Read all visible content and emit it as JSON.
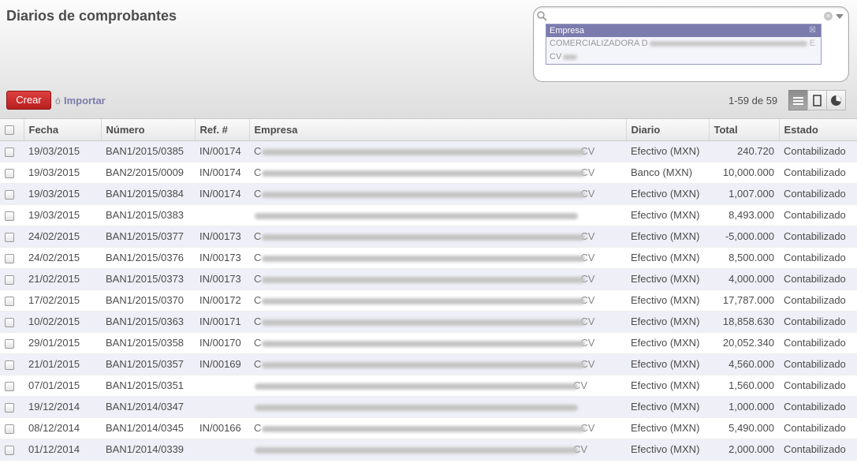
{
  "page": {
    "title": "Diarios de comprobantes"
  },
  "search": {
    "facet_label": "Empresa",
    "facet_values": [
      "COMERCIALIZADORA D",
      "CV"
    ],
    "facet_tail": "E"
  },
  "toolbar": {
    "create_label": "Crear",
    "or_label": "ó",
    "import_label": "Importar"
  },
  "pager": {
    "text": "1-59 de 59"
  },
  "views": [
    {
      "name": "list-view-icon",
      "active": true
    },
    {
      "name": "form-view-icon",
      "active": false
    },
    {
      "name": "graph-view-icon",
      "active": false
    }
  ],
  "table": {
    "columns": [
      "Fecha",
      "Número",
      "Ref. #",
      "Empresa",
      "Diario",
      "Total",
      "Estado"
    ],
    "rows": [
      {
        "fecha": "19/03/2015",
        "numero": "BAN1/2015/0385",
        "ref": "IN/00174",
        "empresa": "C",
        "empresa_tail": "CV",
        "diario": "Efectivo (MXN)",
        "total": "240.720",
        "estado": "Contabilizado"
      },
      {
        "fecha": "19/03/2015",
        "numero": "BAN2/2015/0009",
        "ref": "IN/00174",
        "empresa": "C",
        "empresa_tail": "CV",
        "diario": "Banco (MXN)",
        "total": "10,000.000",
        "estado": "Contabilizado"
      },
      {
        "fecha": "19/03/2015",
        "numero": "BAN1/2015/0384",
        "ref": "IN/00174",
        "empresa": "C",
        "empresa_tail": "CV",
        "diario": "Efectivo (MXN)",
        "total": "1,007.000",
        "estado": "Contabilizado"
      },
      {
        "fecha": "19/03/2015",
        "numero": "BAN1/2015/0383",
        "ref": "",
        "empresa": "",
        "empresa_tail": "",
        "diario": "Efectivo (MXN)",
        "total": "8,493.000",
        "estado": "Contabilizado"
      },
      {
        "fecha": "24/02/2015",
        "numero": "BAN1/2015/0377",
        "ref": "IN/00173",
        "empresa": "C",
        "empresa_tail": "CV",
        "diario": "Efectivo (MXN)",
        "total": "-5,000.000",
        "estado": "Contabilizado"
      },
      {
        "fecha": "24/02/2015",
        "numero": "BAN1/2015/0376",
        "ref": "IN/00173",
        "empresa": "C",
        "empresa_tail": "CV",
        "diario": "Efectivo (MXN)",
        "total": "8,500.000",
        "estado": "Contabilizado"
      },
      {
        "fecha": "21/02/2015",
        "numero": "BAN1/2015/0373",
        "ref": "IN/00173",
        "empresa": "C",
        "empresa_tail": "CV",
        "diario": "Efectivo (MXN)",
        "total": "4,000.000",
        "estado": "Contabilizado"
      },
      {
        "fecha": "17/02/2015",
        "numero": "BAN1/2015/0370",
        "ref": "IN/00172",
        "empresa": "C",
        "empresa_tail": "CV",
        "diario": "Efectivo (MXN)",
        "total": "17,787.000",
        "estado": "Contabilizado"
      },
      {
        "fecha": "10/02/2015",
        "numero": "BAN1/2015/0363",
        "ref": "IN/00171",
        "empresa": "C",
        "empresa_tail": "CV",
        "diario": "Efectivo (MXN)",
        "total": "18,858.630",
        "estado": "Contabilizado"
      },
      {
        "fecha": "29/01/2015",
        "numero": "BAN1/2015/0358",
        "ref": "IN/00170",
        "empresa": "C",
        "empresa_tail": "CV",
        "diario": "Efectivo (MXN)",
        "total": "20,052.340",
        "estado": "Contabilizado"
      },
      {
        "fecha": "21/01/2015",
        "numero": "BAN1/2015/0357",
        "ref": "IN/00169",
        "empresa": "C",
        "empresa_tail": "CV",
        "diario": "Efectivo (MXN)",
        "total": "4,560.000",
        "estado": "Contabilizado"
      },
      {
        "fecha": "07/01/2015",
        "numero": "BAN1/2015/0351",
        "ref": "",
        "empresa": "",
        "empresa_tail": "CV",
        "diario": "Efectivo (MXN)",
        "total": "1,560.000",
        "estado": "Contabilizado"
      },
      {
        "fecha": "19/12/2014",
        "numero": "BAN1/2014/0347",
        "ref": "",
        "empresa": "",
        "empresa_tail": "",
        "diario": "Efectivo (MXN)",
        "total": "1,000.000",
        "estado": "Contabilizado"
      },
      {
        "fecha": "08/12/2014",
        "numero": "BAN1/2014/0345",
        "ref": "IN/00166",
        "empresa": "C",
        "empresa_tail": "CV",
        "diario": "Efectivo (MXN)",
        "total": "5,490.000",
        "estado": "Contabilizado"
      },
      {
        "fecha": "01/12/2014",
        "numero": "BAN1/2014/0339",
        "ref": "",
        "empresa": "",
        "empresa_tail": "CV",
        "diario": "Efectivo (MXN)",
        "total": "2,000.000",
        "estado": "Contabilizado"
      }
    ]
  }
}
